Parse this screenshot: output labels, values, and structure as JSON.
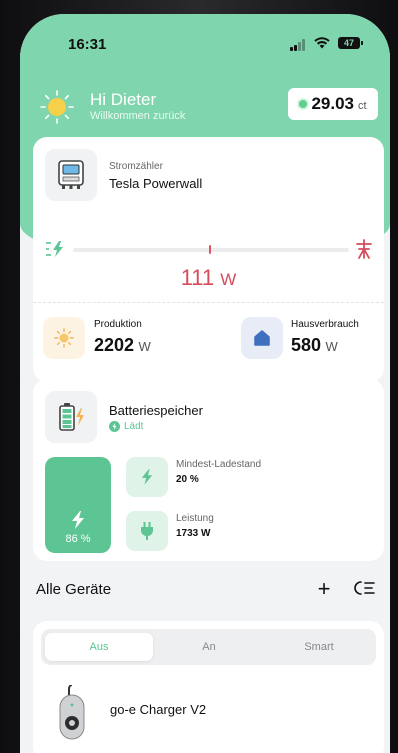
{
  "status": {
    "time": "16:31",
    "battery": "47"
  },
  "header": {
    "greeting": "Hi Dieter",
    "subtitle": "Willkommen zurück",
    "price_value": "29.03",
    "price_unit": "ct"
  },
  "meter": {
    "label": "Stromzähler",
    "name": "Tesla Powerwall",
    "power_value": "111",
    "power_unit": "W",
    "production_label": "Produktion",
    "production_value": "2202",
    "production_unit": "W",
    "consumption_label": "Hausverbrauch",
    "consumption_value": "580",
    "consumption_unit": "W"
  },
  "battery": {
    "title": "Batteriespeicher",
    "status": "Lädt",
    "charge_percent_text": "86 %",
    "charge_fraction": 0.86,
    "min_label": "Mindest-Ladestand",
    "min_value": "20 %",
    "power_label": "Leistung",
    "power_value": "1733 W"
  },
  "devices": {
    "section_title": "Alle Geräte",
    "tabs": [
      "Aus",
      "An",
      "Smart"
    ],
    "active_tab": "Aus",
    "items": [
      {
        "name": "go-e Charger V2"
      }
    ]
  },
  "colors": {
    "accent": "#5cc593",
    "header": "#7fd5ad",
    "negative": "#d64c5c"
  }
}
